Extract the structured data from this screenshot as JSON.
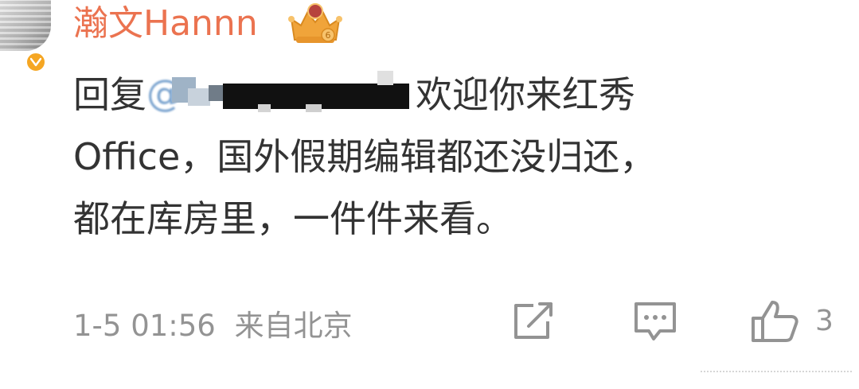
{
  "comment": {
    "username": "瀚文Hannn",
    "verified_icon": "verified-badge-icon",
    "crown_icon": "crown-badge-icon",
    "reply_prefix": "回复",
    "mention_symbol": "@",
    "text_line1_after_mention": "欢迎你来红秀",
    "text_line2": "Office，国外假期编辑都还没归还，",
    "text_line3": "都在库房里，一件件来看。",
    "timestamp": "1-5 01:56",
    "source": "来自北京",
    "like_count": "3"
  },
  "icons": {
    "share": "share-icon",
    "comment": "comment-icon",
    "like": "thumbs-up-icon"
  },
  "colors": {
    "username": "#eb7350",
    "text": "#333333",
    "meta": "#939393",
    "verified": "#f5a623",
    "crown": "#f0a43a"
  }
}
